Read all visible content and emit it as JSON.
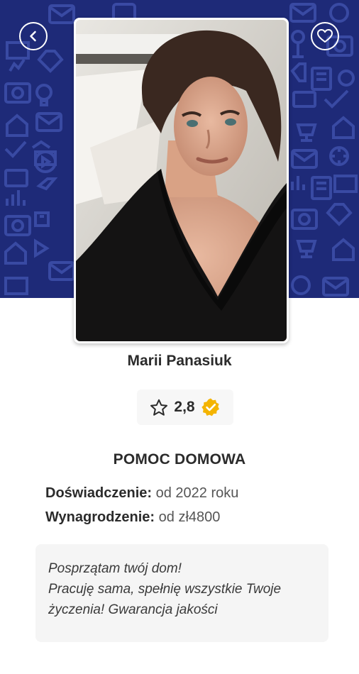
{
  "profile": {
    "name": "Marii Panasiuk",
    "rating": "2,8",
    "category": "POMOC DOMOWA",
    "experience_label": "Doświadczenie:",
    "experience_value": "od 2022 roku",
    "salary_label": "Wynagrodzenie:",
    "salary_value": "od zł4800",
    "description_lines": [
      "Posprzątam twój dom!",
      "Pracuję sama, spełnię wszystkie Twoje",
      "życzenia! Gwarancja jakości"
    ]
  },
  "icons": {
    "back": "chevron-left-icon",
    "favorite": "heart-icon",
    "rating": "star-outline-icon",
    "verified": "verified-badge-icon"
  },
  "colors": {
    "hero_background": "#1e2a78",
    "hero_pattern": "#3d4ea8",
    "verified_badge": "#f4b400"
  }
}
